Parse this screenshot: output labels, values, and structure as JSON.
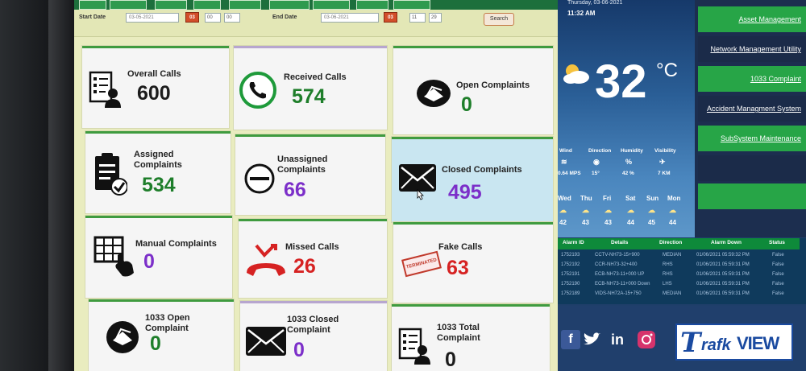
{
  "filter": {
    "start_label": "Start Date",
    "start_value": "03-05-2021",
    "start_cal": "03",
    "start_hour": "00",
    "start_min": "00",
    "end_label": "End Date",
    "end_value": "03-06-2021",
    "end_cal": "03",
    "end_hour": "11",
    "end_min": "29",
    "search_label": "Search"
  },
  "cards": [
    {
      "title": "Overall Calls",
      "value": "600"
    },
    {
      "title": "Received Calls",
      "value": "574"
    },
    {
      "title": "Open Complaints",
      "value": "0"
    },
    {
      "title": "Assigned Complaints",
      "value": "534"
    },
    {
      "title": "Unassigned Complaints",
      "value": "66"
    },
    {
      "title": "Closed Complaints",
      "value": "495"
    },
    {
      "title": "Manual Complaints",
      "value": "0"
    },
    {
      "title": "Missed Calls",
      "value": "26"
    },
    {
      "title": "Fake Calls",
      "value": "63"
    },
    {
      "title": "1033 Open Complaint",
      "value": "0"
    },
    {
      "title": "1033 Closed Complaint",
      "value": "0"
    },
    {
      "title": "1033 Total Complaint",
      "value": "0"
    }
  ],
  "stamp_text": "TERMINATED",
  "weather": {
    "date": "Thursday, 03-06-2021",
    "time": "11:32 AM",
    "temp": "32",
    "unit": "°C",
    "labels": [
      "Wind",
      "Direction",
      "Humidity",
      "Visibility"
    ],
    "values": [
      "0.64 MPS",
      "15°",
      "42 %",
      "7 KM"
    ],
    "days": [
      "Wed",
      "Thu",
      "Fri",
      "Sat",
      "Sun",
      "Mon"
    ],
    "temps": [
      "42",
      "43",
      "43",
      "44",
      "45",
      "44"
    ]
  },
  "menu": [
    "Asset Management",
    "Network Management Utility",
    "1033 Complaint",
    "Accident Managment System",
    "SubSystem Maintenance",
    "",
    ""
  ],
  "alarm": {
    "headers": [
      "Alarm ID",
      "Details",
      "Direction",
      "Alarm Down",
      "Status"
    ],
    "rows": [
      [
        "1752193",
        "CCTV-NH73-15+900",
        "MEDIAN",
        "01/06/2021 05:59:32 PM",
        "False"
      ],
      [
        "1752192",
        "CCR-NH73-32+400",
        "RHS",
        "01/06/2021 05:59:31 PM",
        "False"
      ],
      [
        "1752191",
        "ECB-NH73-11+000 UP",
        "RHS",
        "01/06/2021 05:59:31 PM",
        "False"
      ],
      [
        "1752190",
        "ECB-NH73-11+000 Down",
        "LHS",
        "01/06/2021 05:59:31 PM",
        "False"
      ],
      [
        "1752189",
        "VIDS-NH72A-15+750",
        "MEDIAN",
        "01/06/2021 05:59:31 PM",
        "False"
      ]
    ]
  },
  "social": {
    "facebook": "f",
    "linkedin": "in"
  },
  "logo": {
    "t": "T",
    "rafk": "rafk",
    "view": "VIEW"
  }
}
